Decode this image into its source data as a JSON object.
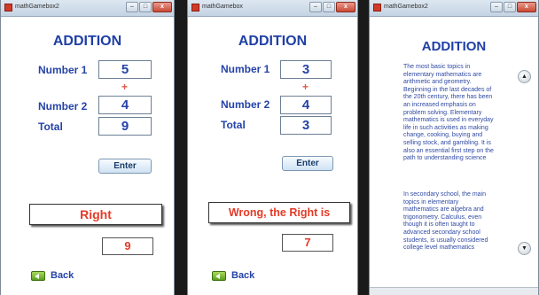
{
  "window_title_1": "mathGamebox2",
  "window_title_2": "mathGamebox",
  "window_title_3": "mathGamebox2",
  "ctrl_minimize": "–",
  "ctrl_maximize": "□",
  "ctrl_close": "x",
  "screen1": {
    "title": "ADDITION",
    "number1_label": "Number 1",
    "number1_value": "5",
    "plus": "+",
    "number2_label": "Number 2",
    "number2_value": "4",
    "total_label": "Total",
    "total_value": "9",
    "enter_label": "Enter",
    "result_text": "Right",
    "answer_value": "9",
    "back_label": "Back"
  },
  "screen2": {
    "title": "ADDITION",
    "number1_label": "Number 1",
    "number1_value": "3",
    "plus": "+",
    "number2_label": "Number 2",
    "number2_value": "4",
    "total_label": "Total",
    "total_value": "3",
    "enter_label": "Enter",
    "result_text": "Wrong, the Right is",
    "answer_value": "7",
    "back_label": "Back"
  },
  "screen3": {
    "title": "ADDITION",
    "para1": "The most basic topics in\nelementary mathematics are\narithmetic and geometry.\nBeginning in the last decades of\nthe 20th century, there has been\nan increased emphasis on\nproblem solving. Elementary\nmathematics is used in everyday\nlife in such activities as making\nchange, cooking, buying and\nselling stock, and gambling. It is\nalso an essential first step on the\npath to understanding science",
    "para2": "In secondary school, the main\ntopics in elementary\nmathematics are algebra and\ntrigonometry. Calculus, even\nthough it is often taught to\nadvanced secondary school\nstudents, is usually considered\ncollege level mathematics",
    "scroll_up": "▲",
    "scroll_down": "▼"
  },
  "colors": {
    "heading": "#1f3fa6",
    "result_red": "#e53a27",
    "plus_red": "#e25a4a"
  }
}
